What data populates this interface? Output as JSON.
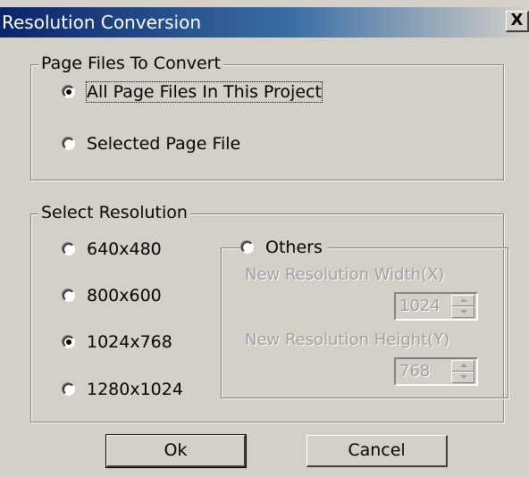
{
  "window": {
    "title": "Resolution Conversion",
    "close_label": "X"
  },
  "page_files": {
    "legend": "Page Files To Convert",
    "options": [
      "All Page Files In This Project",
      "Selected Page File"
    ],
    "selected_index": 0
  },
  "resolution": {
    "legend": "Select Resolution",
    "options": [
      "640x480",
      "800x600",
      "1024x768",
      "1280x1024"
    ],
    "selected_index": 2,
    "others": {
      "label": "Others",
      "width_label": "New Resolution Width(X)",
      "width_value": "1024",
      "height_label": "New Resolution Height(Y)",
      "height_value": "768"
    }
  },
  "buttons": {
    "ok": "Ok",
    "cancel": "Cancel"
  }
}
